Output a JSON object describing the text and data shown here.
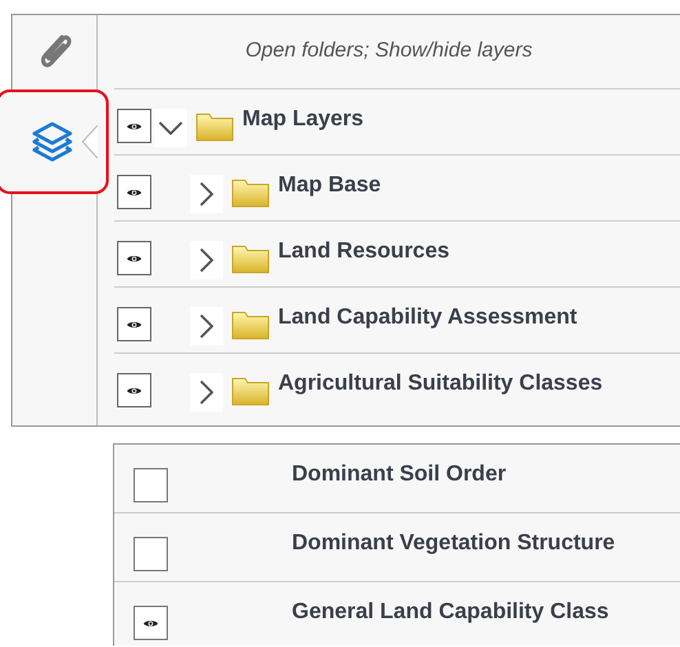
{
  "sidebar": {
    "tabs": [
      {
        "kind": "attachment",
        "selected": false
      },
      {
        "kind": "layers",
        "selected": true
      }
    ]
  },
  "layers_panel": {
    "hint": "Open folders; Show/hide layers",
    "layers": [
      {
        "label": "Map Layers",
        "visible": true,
        "expanded": true,
        "children": [
          {
            "label": "Map Base",
            "visible": true,
            "expanded": false
          },
          {
            "label": "Land Resources",
            "visible": true,
            "expanded": false
          },
          {
            "label": "Land Capability Assessment",
            "visible": true,
            "expanded": false
          },
          {
            "label": "Agricultural Suitability Classes",
            "visible": true,
            "expanded": false
          }
        ]
      }
    ]
  },
  "layer_list": [
    {
      "label": "Dominant Soil Order",
      "visible": false
    },
    {
      "label": "Dominant Vegetation Structure",
      "visible": false
    },
    {
      "label": "General Land Capability Class",
      "visible": true
    }
  ]
}
